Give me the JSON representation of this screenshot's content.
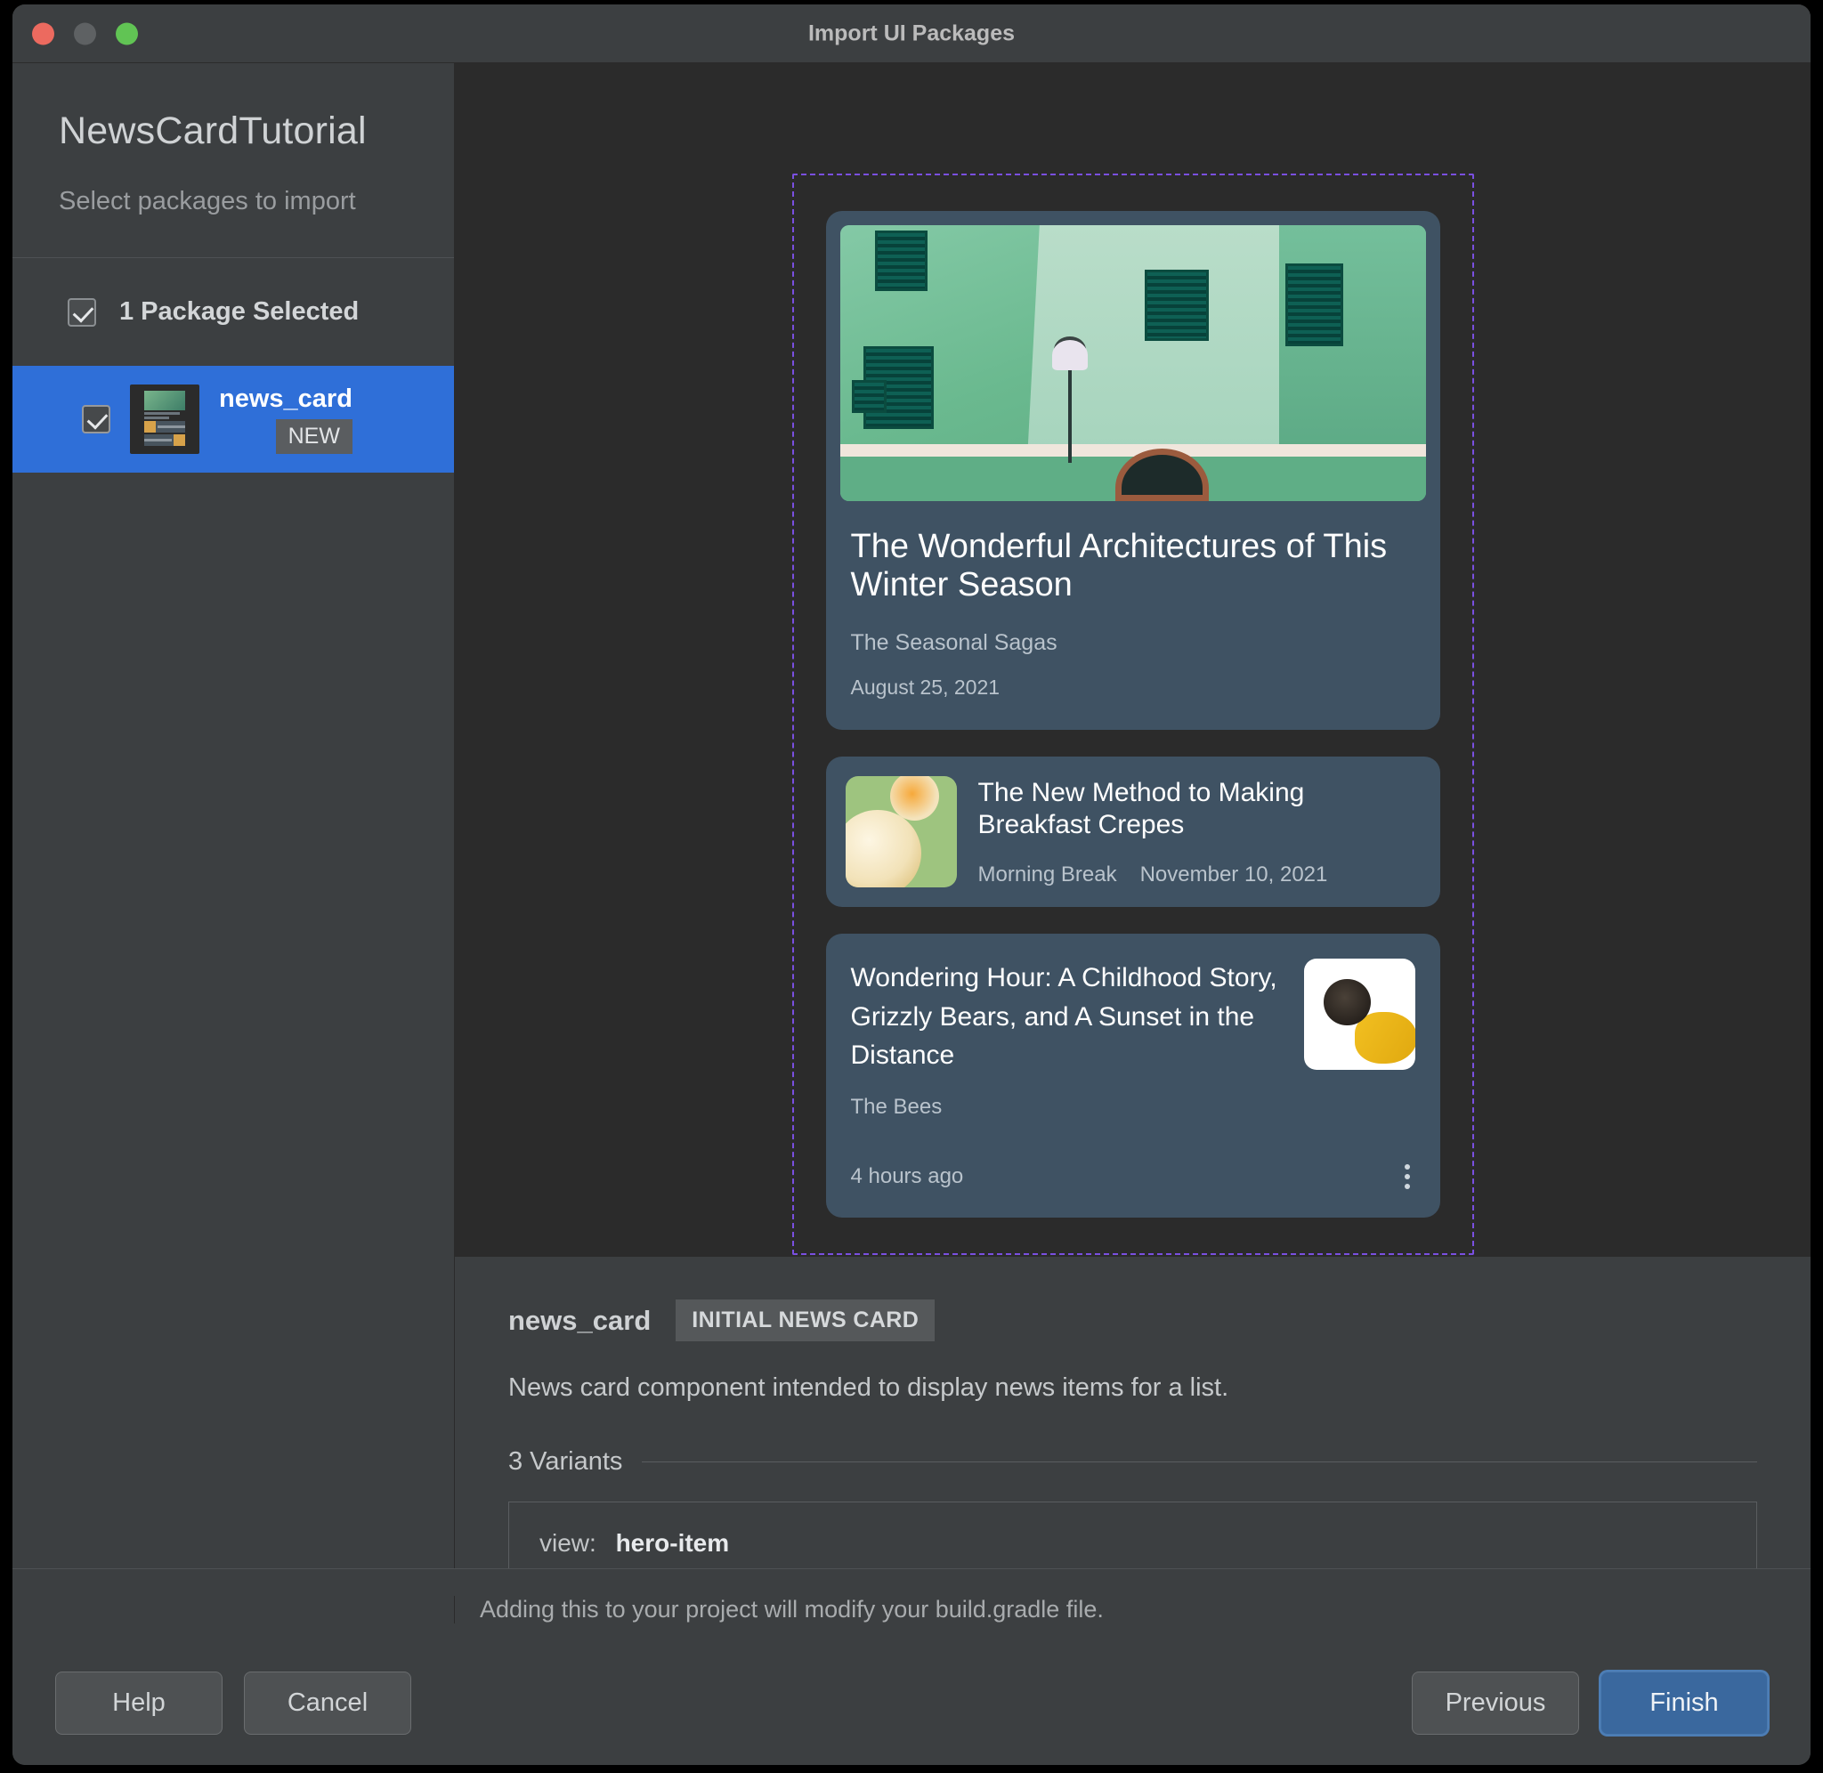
{
  "window": {
    "title": "Import UI Packages",
    "traffic_lights": [
      "close-button",
      "minimize-button",
      "zoom-button"
    ]
  },
  "sidebar": {
    "project_title": "NewsCardTutorial",
    "subtitle": "Select packages to import",
    "selection_summary": "1 Package Selected",
    "packages": [
      {
        "name": "news_card",
        "badge": "NEW",
        "checked": true,
        "selected": true
      }
    ]
  },
  "preview": {
    "hero": {
      "title": "The Wonderful Architectures of This Winter Season",
      "source": "The Seasonal Sagas",
      "date": "August 25, 2021"
    },
    "items": [
      {
        "title": "The New Method to Making Breakfast Crepes",
        "source": "Morning Break",
        "date": "November 10, 2021"
      }
    ],
    "story": {
      "title": "Wondering Hour: A Childhood Story, Grizzly Bears, and A Sunset in the Distance",
      "source": "The Bees",
      "time": "4 hours ago",
      "menu_icon": "kebab-menu-icon"
    }
  },
  "details": {
    "name": "news_card",
    "tag": "INITIAL NEWS CARD",
    "description": "News card component intended to display news items for a list.",
    "variants_label": "3 Variants",
    "variants": [
      {
        "key": "view:",
        "value": "hero-item"
      }
    ]
  },
  "footer": {
    "note": "Adding this to your project will modify your build.gradle file.",
    "help_label": "Help",
    "cancel_label": "Cancel",
    "previous_label": "Previous",
    "finish_label": "Finish"
  },
  "colors": {
    "accent_selection": "#2f6fd8",
    "primary_button": "#3a689e",
    "dashed_outline": "#7a4fe0",
    "card_background": "#3f5263",
    "window_background": "#3c3f41",
    "canvas_background": "#2b2b2b"
  }
}
